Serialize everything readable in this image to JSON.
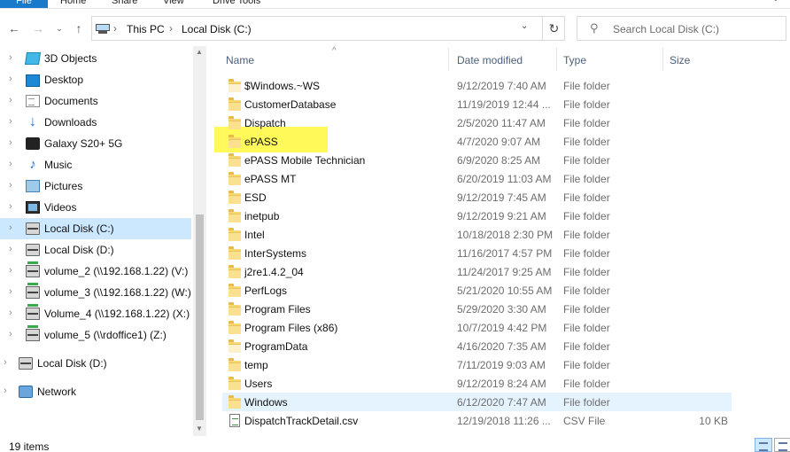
{
  "ribbon": {
    "file_tab": "File",
    "tabs": [
      "Home",
      "Share",
      "View",
      "Drive Tools"
    ]
  },
  "address": {
    "crumbs": [
      "This PC",
      "Local Disk (C:)"
    ],
    "separator": "›"
  },
  "search": {
    "placeholder": "Search Local Disk (C:)"
  },
  "navpane": {
    "items": [
      {
        "label": "3D Objects",
        "icon": "cube-icon"
      },
      {
        "label": "Desktop",
        "icon": "desktop-icon"
      },
      {
        "label": "Documents",
        "icon": "documents-icon"
      },
      {
        "label": "Downloads",
        "icon": "download-arrow-icon"
      },
      {
        "label": "Galaxy S20+ 5G",
        "icon": "phone-icon"
      },
      {
        "label": "Music",
        "icon": "music-note-icon"
      },
      {
        "label": "Pictures",
        "icon": "pictures-icon"
      },
      {
        "label": "Videos",
        "icon": "film-icon"
      },
      {
        "label": "Local Disk (C:)",
        "icon": "hard-drive-icon",
        "selected": true
      },
      {
        "label": "Local Disk (D:)",
        "icon": "hard-drive-icon"
      },
      {
        "label": "volume_2 (\\\\192.168.1.22) (V:)",
        "icon": "network-drive-icon"
      },
      {
        "label": "volume_3 (\\\\192.168.1.22) (W:)",
        "icon": "network-drive-icon"
      },
      {
        "label": "Volume_4 (\\\\192.168.1.22) (X:)",
        "icon": "network-drive-icon"
      },
      {
        "label": "volume_5 (\\\\rdoffice1) (Z:)",
        "icon": "network-drive-icon"
      }
    ],
    "top_items": [
      {
        "label": "Local Disk (D:)",
        "icon": "hard-drive-icon"
      },
      {
        "label": "Network",
        "icon": "network-icon"
      }
    ]
  },
  "columns": {
    "name": "Name",
    "date": "Date modified",
    "type": "Type",
    "size": "Size"
  },
  "files": [
    {
      "name": "$Windows.~WS",
      "date": "9/12/2019 7:40 AM",
      "type": "File folder",
      "size": "",
      "faded": true
    },
    {
      "name": "CustomerDatabase",
      "date": "11/19/2019 12:44 ...",
      "type": "File folder",
      "size": ""
    },
    {
      "name": "Dispatch",
      "date": "2/5/2020 11:47 AM",
      "type": "File folder",
      "size": ""
    },
    {
      "name": "ePASS",
      "date": "4/7/2020 9:07 AM",
      "type": "File folder",
      "size": ""
    },
    {
      "name": "ePASS Mobile Technician",
      "date": "6/9/2020 8:25 AM",
      "type": "File folder",
      "size": ""
    },
    {
      "name": "ePASS MT",
      "date": "6/20/2019 11:03 AM",
      "type": "File folder",
      "size": ""
    },
    {
      "name": "ESD",
      "date": "9/12/2019 7:45 AM",
      "type": "File folder",
      "size": ""
    },
    {
      "name": "inetpub",
      "date": "9/12/2019 9:21 AM",
      "type": "File folder",
      "size": ""
    },
    {
      "name": "Intel",
      "date": "10/18/2018 2:30 PM",
      "type": "File folder",
      "size": ""
    },
    {
      "name": "InterSystems",
      "date": "11/16/2017 4:57 PM",
      "type": "File folder",
      "size": ""
    },
    {
      "name": "j2re1.4.2_04",
      "date": "11/24/2017 9:25 AM",
      "type": "File folder",
      "size": ""
    },
    {
      "name": "PerfLogs",
      "date": "5/21/2020 10:55 AM",
      "type": "File folder",
      "size": ""
    },
    {
      "name": "Program Files",
      "date": "5/29/2020 3:30 AM",
      "type": "File folder",
      "size": ""
    },
    {
      "name": "Program Files (x86)",
      "date": "10/7/2019 4:42 PM",
      "type": "File folder",
      "size": ""
    },
    {
      "name": "ProgramData",
      "date": "4/16/2020 7:35 AM",
      "type": "File folder",
      "size": "",
      "faded": true
    },
    {
      "name": "temp",
      "date": "7/11/2019 9:03 AM",
      "type": "File folder",
      "size": ""
    },
    {
      "name": "Users",
      "date": "9/12/2019 8:24 AM",
      "type": "File folder",
      "size": ""
    },
    {
      "name": "Windows",
      "date": "6/12/2020 7:47 AM",
      "type": "File folder",
      "size": "",
      "hover": true
    },
    {
      "name": "DispatchTrackDetail.csv",
      "date": "12/19/2018 11:26 ...",
      "type": "CSV File",
      "size": "10 KB",
      "csv": true
    }
  ],
  "status": {
    "item_count": "19 items"
  },
  "colors": {
    "accent": "#1979ca",
    "selection": "#cce8ff",
    "hover": "#e5f3ff",
    "highlight": "#fff83c"
  }
}
